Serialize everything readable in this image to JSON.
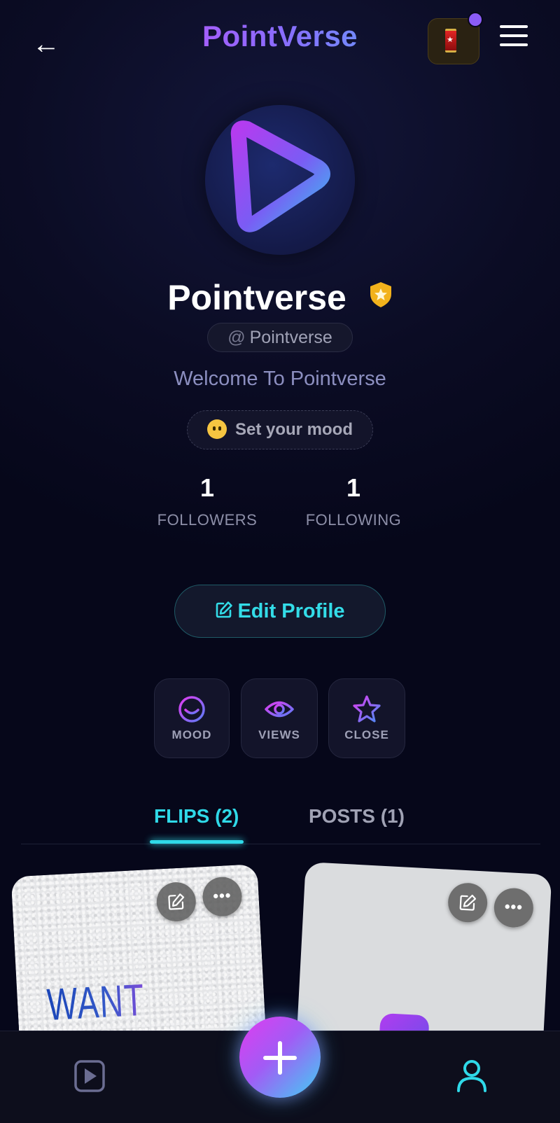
{
  "header": {
    "back_glyph": "←",
    "title": "PointVerse",
    "menu_icon": "hamburger-icon",
    "badge_icon": "lantern-badge-icon"
  },
  "profile": {
    "name": "Pointverse",
    "verified_icon": "shield-star-icon",
    "handle_at": "@",
    "handle": "Pointverse",
    "bio": "Welcome To Pointverse",
    "mood_label": "Set your mood",
    "mood_icon": "neutral-face-emoji-icon"
  },
  "stats": {
    "followers_count": "1",
    "followers_label": "FOLLOWERS",
    "following_count": "1",
    "following_label": "FOLLOWING"
  },
  "edit_profile_label": "Edit Profile",
  "actions": {
    "mood": "MOOD",
    "views": "VIEWS",
    "close": "CLOSE"
  },
  "tabs": {
    "flips": "FLIPS (2)",
    "posts": "POSTS (1)"
  },
  "cards": {
    "first_text": "WANT",
    "more_glyph": "•••"
  },
  "colors": {
    "accent_cyan": "#2fd9e8",
    "accent_magenta": "#e03cf0",
    "accent_purple": "#8a6cff",
    "background": "#07081a"
  }
}
